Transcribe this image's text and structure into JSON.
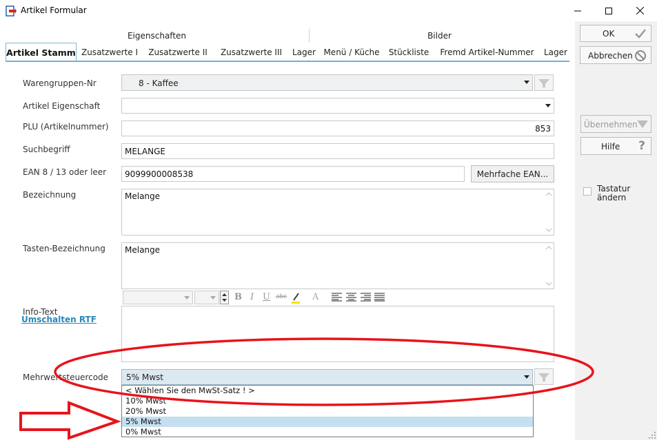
{
  "window": {
    "title": "Artikel Formular"
  },
  "tab_groups": {
    "left": "Eigenschaften",
    "right": "Bilder"
  },
  "tabs": [
    {
      "label": "Artikel Stamm",
      "active": true
    },
    {
      "label": "Zusatzwerte I"
    },
    {
      "label": "Zusatzwerte II"
    },
    {
      "label": "Zusatzwerte III"
    },
    {
      "label": "Lager"
    },
    {
      "label": "Menü / Küche"
    },
    {
      "label": "Stückliste"
    },
    {
      "label": "Fremd Artikel-Nummer"
    },
    {
      "label": "Lager"
    }
  ],
  "form": {
    "warengruppe": {
      "label": "Warengruppen-Nr",
      "value": "8 - Kaffee"
    },
    "eigenschaft": {
      "label": "Artikel Eigenschaft",
      "value": ""
    },
    "plu": {
      "label": "PLU (Artikelnummer)",
      "value": "853"
    },
    "suchbegriff": {
      "label": "Suchbegriff",
      "value": "MELANGE"
    },
    "ean": {
      "label": "EAN 8 / 13 oder leer",
      "value": "9099900008538",
      "button": "Mehrfache EAN..."
    },
    "bezeichnung": {
      "label": "Bezeichnung",
      "value": "Melange"
    },
    "tasten": {
      "label": "Tasten-Bezeichnung",
      "value": "Melange"
    },
    "info": {
      "label": "Info-Text",
      "link": "Umschalten RTF"
    },
    "mwst": {
      "label": "Mehrwertsteuercode",
      "value": "5% Mwst"
    }
  },
  "rtf_toolbar": {
    "bold": "B",
    "italic": "I",
    "underline": "U",
    "strike": "abc",
    "font_color": "A"
  },
  "mwst_options": [
    {
      "label": "< Wählen Sie den MwSt-Satz ! >"
    },
    {
      "label": "10% Mwst"
    },
    {
      "label": "20% Mwst"
    },
    {
      "label": "5% Mwst",
      "selected": true
    },
    {
      "label": "0% Mwst"
    }
  ],
  "side": {
    "ok": "OK",
    "abbrechen": "Abbrechen",
    "uebernehmen": "Übernehmen",
    "hilfe": "Hilfe",
    "hilfe_symbol": "?",
    "tastatur_label_1": "Tastatur",
    "tastatur_label_2": "ändern"
  },
  "colors": {
    "accent": "#6fb0d6",
    "annotation": "#e8131b",
    "selection": "#c5dff0"
  }
}
